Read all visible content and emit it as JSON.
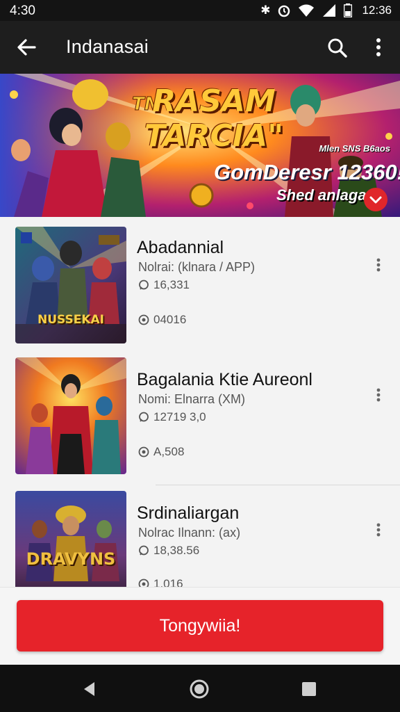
{
  "status_bar": {
    "time": "4:30",
    "clock": "12:36",
    "icons": [
      "bluetooth-icon",
      "alarm-icon",
      "wifi-icon",
      "signal-icon",
      "battery-icon"
    ]
  },
  "app_bar": {
    "title": "Indanasai"
  },
  "banner": {
    "title_line1": "RASAM",
    "title_line2": "TARCIA\"",
    "tagline": "Mlen SNS B6aos",
    "subtitle": "GomDeresr 12360!",
    "cta": "Shed anlagaa"
  },
  "items": [
    {
      "title": "Abadannial",
      "meta": "Nolrai: (klnara / APP)",
      "stat1": "16,331",
      "stat2": "04016",
      "thumb_caption": "NUSSEKAI"
    },
    {
      "title": "Bagalania Ktie Aureonl",
      "meta": "Nomi: Elnarra (XM)",
      "stat1": "12719 3,0",
      "stat2": "A,508",
      "thumb_caption": ""
    },
    {
      "title": "Srdinaliargan",
      "meta": "Nolrac Ilnann: (ax)",
      "stat1": "18,38.56",
      "stat2": "1,016",
      "thumb_caption": "DRAVYNS"
    }
  ],
  "cta_button": {
    "label": "Tongywiia!"
  },
  "colors": {
    "accent": "#e6232a",
    "app_bar": "#1e1e1e",
    "status_bar": "#141414"
  }
}
